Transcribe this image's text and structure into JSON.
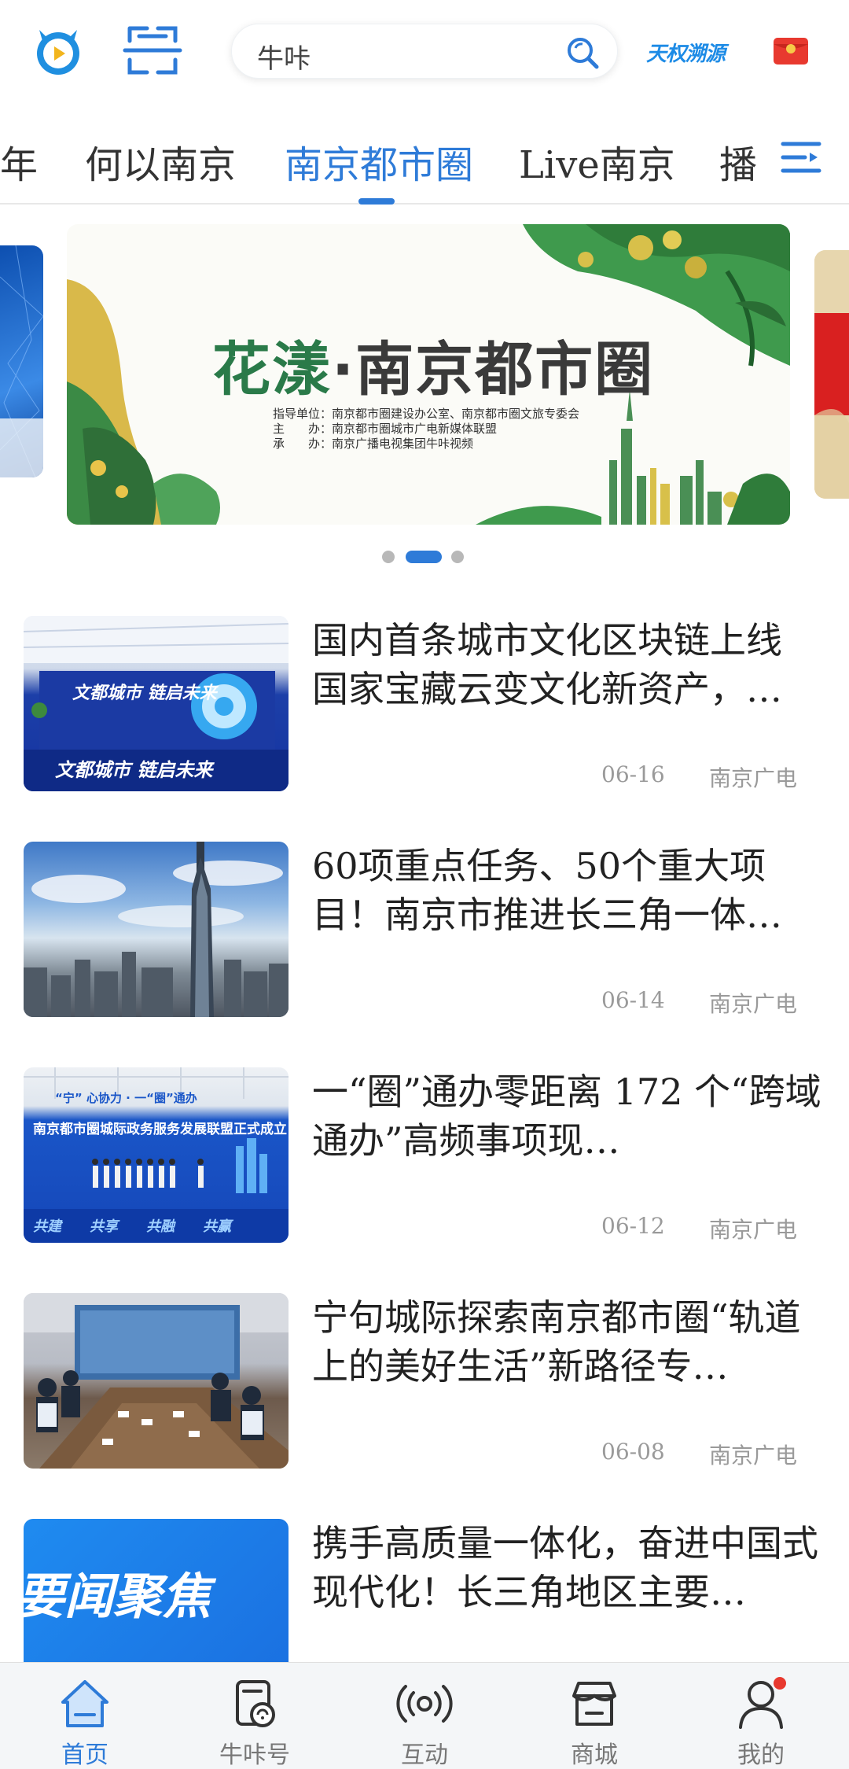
{
  "header": {
    "search_text": "牛咔",
    "brand_text": "天权溯源"
  },
  "tabs": [
    {
      "label": "年"
    },
    {
      "label": "何以南京"
    },
    {
      "label": "南京都市圈"
    },
    {
      "label": "Live南京"
    },
    {
      "label": "播"
    }
  ],
  "active_tab": "南京都市圈",
  "banner": {
    "title_part1": "花漾",
    "title_part2": "·南京都市圈",
    "credits": [
      "指导单位：南京都市圈建设办公室、南京都市圈文旅专委会",
      "主　　办：南京都市圈城市广电新媒体联盟",
      "承　　办：南京广播电视集团牛咔视频"
    ]
  },
  "news": [
    {
      "title": "国内首条城市文化区块链上线 国家宝藏云变文化新资产，…",
      "date": "06-16",
      "source": "南京广电",
      "thumb_text_1": "文都城市 链启未来",
      "thumb_text_2": "文都城市 链启未来"
    },
    {
      "title": "60项重点任务、50个重大项目！南京市推进长三角一体…",
      "date": "06-14",
      "source": "南京广电"
    },
    {
      "title": "一“圈”通办零距离 172 个“跨域通办”高频事项现…",
      "date": "06-12",
      "source": "南京广电",
      "thumb_text_1": "南京都市圈城际政务服务发展联盟正式成立",
      "thumb_text_2": "共建　　共享　　共融　　共赢"
    },
    {
      "title": "宁句城际探索南京都市圈“轨道上的美好生活”新路径专…",
      "date": "06-08",
      "source": "南京广电"
    },
    {
      "title": "携手高质量一体化，奋进中国式现代化！长三角地区主要…",
      "date": "",
      "source": "",
      "thumb_text_1": "要闻聚焦"
    }
  ],
  "bottom_nav": [
    {
      "label": "首页",
      "icon": "home-icon"
    },
    {
      "label": "牛咔号",
      "icon": "niuka-account-icon"
    },
    {
      "label": "互动",
      "icon": "broadcast-icon"
    },
    {
      "label": "商城",
      "icon": "store-icon"
    },
    {
      "label": "我的",
      "icon": "profile-icon"
    }
  ],
  "colors": {
    "accent": "#2e7bd8",
    "notification_dot": "#e8392f"
  }
}
